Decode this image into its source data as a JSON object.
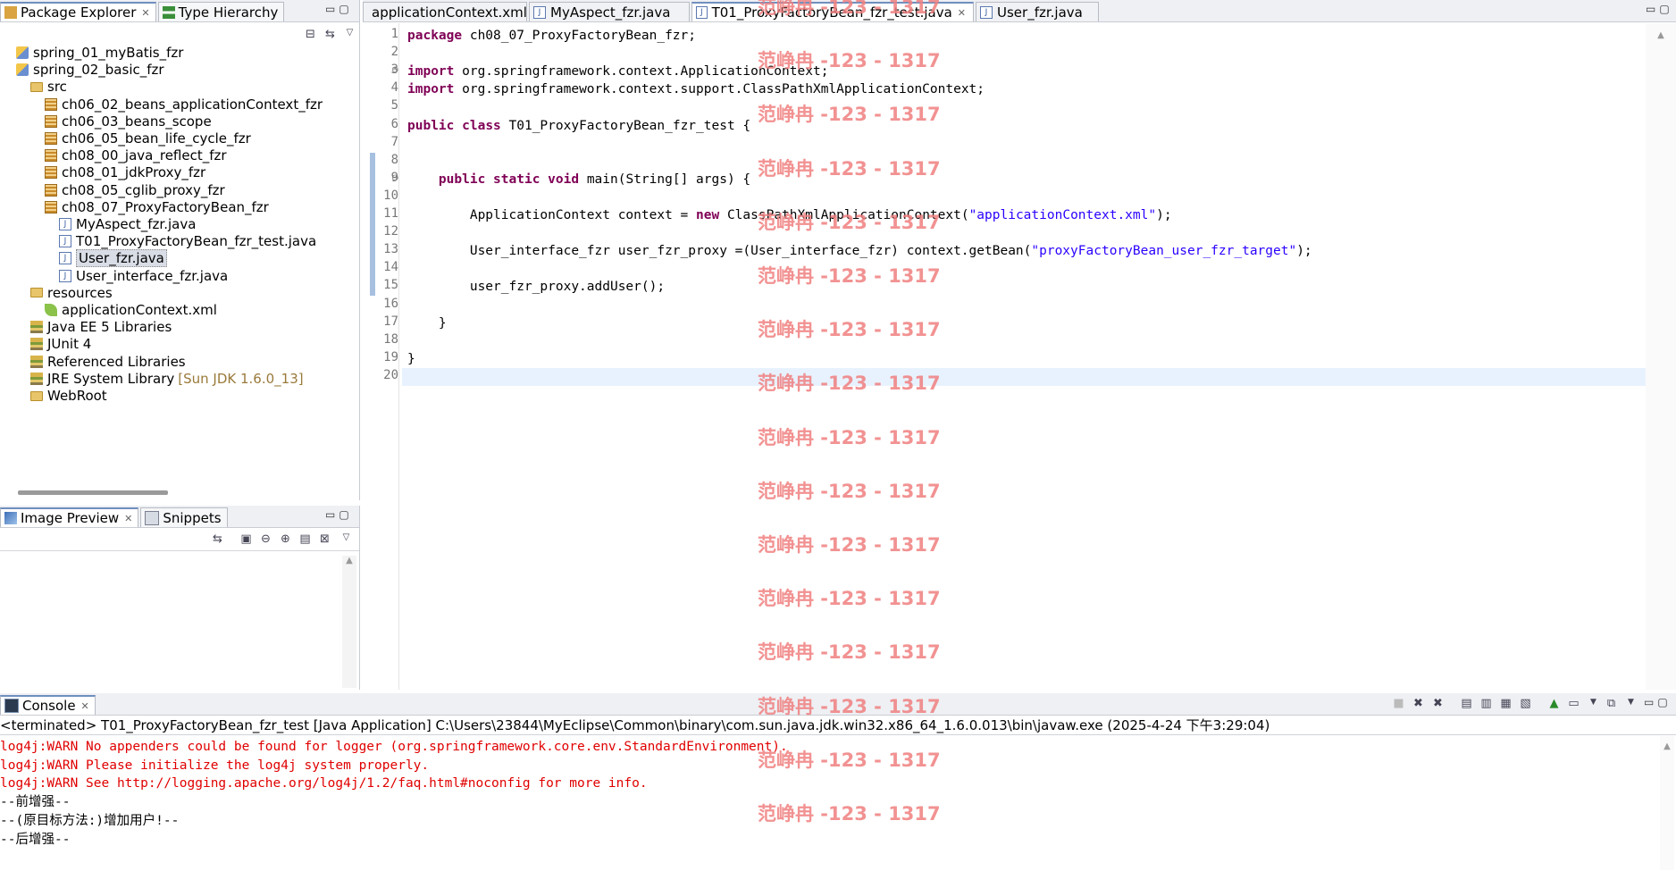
{
  "package_explorer": {
    "tabs": [
      {
        "label": "Package Explorer",
        "active": true
      },
      {
        "label": "Type Hierarchy",
        "active": false
      }
    ],
    "tree": [
      {
        "label": "spring_01_myBatis_fzr",
        "icon": "project-icon",
        "depth": 0
      },
      {
        "label": "spring_02_basic_fzr",
        "icon": "project-icon",
        "depth": 0
      },
      {
        "label": "src",
        "icon": "source-folder-icon",
        "depth": 1
      },
      {
        "label": "ch06_02_beans_applicationContext_fzr",
        "icon": "package-icon",
        "depth": 2
      },
      {
        "label": "ch06_03_beans_scope",
        "icon": "package-icon",
        "depth": 2
      },
      {
        "label": "ch06_05_bean_life_cycle_fzr",
        "icon": "package-icon",
        "depth": 2
      },
      {
        "label": "ch08_00_java_reflect_fzr",
        "icon": "package-icon",
        "depth": 2
      },
      {
        "label": "ch08_01_jdkProxy_fzr",
        "icon": "package-icon",
        "depth": 2
      },
      {
        "label": "ch08_05_cglib_proxy_fzr",
        "icon": "package-icon",
        "depth": 2
      },
      {
        "label": "ch08_07_ProxyFactoryBean_fzr",
        "icon": "package-icon",
        "depth": 2
      },
      {
        "label": "MyAspect_fzr.java",
        "icon": "java-file-icon",
        "depth": 3
      },
      {
        "label": "T01_ProxyFactoryBean_fzr_test.java",
        "icon": "java-file-icon",
        "depth": 3
      },
      {
        "label": "User_fzr.java",
        "icon": "java-file-icon",
        "depth": 3,
        "selected": true
      },
      {
        "label": "User_interface_fzr.java",
        "icon": "java-file-icon",
        "depth": 3
      },
      {
        "label": "resources",
        "icon": "source-folder-icon",
        "depth": 1
      },
      {
        "label": "applicationContext.xml",
        "icon": "xml-file-icon",
        "depth": 2
      },
      {
        "label": "Java EE 5 Libraries",
        "icon": "library-icon",
        "depth": 1
      },
      {
        "label": "JUnit 4",
        "icon": "library-icon",
        "depth": 1
      },
      {
        "label": "Referenced Libraries",
        "icon": "library-icon",
        "depth": 1
      },
      {
        "label": "JRE System Library",
        "suffix": "[Sun JDK 1.6.0_13]",
        "icon": "library-icon",
        "depth": 1
      },
      {
        "label": "WebRoot",
        "icon": "folder-icon",
        "depth": 1
      }
    ]
  },
  "image_preview": {
    "tabs": [
      {
        "label": "Image Preview",
        "active": true
      },
      {
        "label": "Snippets",
        "active": false
      }
    ]
  },
  "editor": {
    "tabs": [
      {
        "label": "applicationContext.xml",
        "icon": "xml-file-icon",
        "active": false
      },
      {
        "label": "MyAspect_fzr.java",
        "icon": "java-file-icon",
        "active": false
      },
      {
        "label": "T01_ProxyFactoryBean_fzr_test.java",
        "icon": "java-file-icon",
        "active": true
      },
      {
        "label": "User_fzr.java",
        "icon": "java-file-icon",
        "active": false
      }
    ],
    "current_line": 20,
    "lines": [
      [
        {
          "t": "package",
          "k": "kw"
        },
        {
          "t": " ch08_07_ProxyFactoryBean_fzr;"
        }
      ],
      [],
      [
        {
          "t": "import",
          "k": "kw"
        },
        {
          "t": " org.springframework.context.ApplicationContext;"
        }
      ],
      [
        {
          "t": "import",
          "k": "kw"
        },
        {
          "t": " org.springframework.context.support.ClassPathXmlApplicationContext;"
        }
      ],
      [],
      [
        {
          "t": "public",
          "k": "kw"
        },
        {
          "t": " "
        },
        {
          "t": "class",
          "k": "kw"
        },
        {
          "t": " T01_ProxyFactoryBean_fzr_test {"
        }
      ],
      [],
      [],
      [
        {
          "t": "    "
        },
        {
          "t": "public",
          "k": "kw"
        },
        {
          "t": " "
        },
        {
          "t": "static",
          "k": "kw"
        },
        {
          "t": " "
        },
        {
          "t": "void",
          "k": "kw"
        },
        {
          "t": " main(String[] args) {"
        }
      ],
      [],
      [
        {
          "t": "        ApplicationContext context = "
        },
        {
          "t": "new",
          "k": "kw"
        },
        {
          "t": " ClassPathXmlApplicationContext("
        },
        {
          "t": "\"applicationContext.xml\"",
          "k": "str"
        },
        {
          "t": ");"
        }
      ],
      [],
      [
        {
          "t": "        User_interface_fzr user_fzr_proxy =(User_interface_fzr) context.getBean("
        },
        {
          "t": "\"proxyFactoryBean_user_fzr_target\"",
          "k": "str"
        },
        {
          "t": ");"
        }
      ],
      [],
      [
        {
          "t": "        user_fzr_proxy.addUser();"
        }
      ],
      [],
      [
        {
          "t": "    }"
        }
      ],
      [],
      [
        {
          "t": "}"
        }
      ],
      []
    ]
  },
  "console": {
    "tab_label": "Console",
    "header": "<terminated> T01_ProxyFactoryBean_fzr_test [Java Application] C:\\Users\\23844\\MyEclipse\\Common\\binary\\com.sun.java.jdk.win32.x86_64_1.6.0.013\\bin\\javaw.exe (2025-4-24 下午3:29:04)",
    "lines": [
      {
        "text": "log4j:WARN No appenders could be found for logger (org.springframework.core.env.StandardEnvironment).",
        "warn": true
      },
      {
        "text": "log4j:WARN Please initialize the log4j system properly.",
        "warn": true
      },
      {
        "text": "log4j:WARN See http://logging.apache.org/log4j/1.2/faq.html#noconfig for more info.",
        "warn": true
      },
      {
        "text": "--前增强--",
        "warn": false
      },
      {
        "text": "--(原目标方法:)增加用户!--",
        "warn": false
      },
      {
        "text": "--后增强--",
        "warn": false
      }
    ]
  },
  "watermark": "范峥冉 -123 - 1317",
  "colors": {
    "keyword": "#7f0055",
    "string": "#2a00ff",
    "warn": "#e00000",
    "watermark": "#f08080",
    "current_line": "#e8f2fe"
  }
}
